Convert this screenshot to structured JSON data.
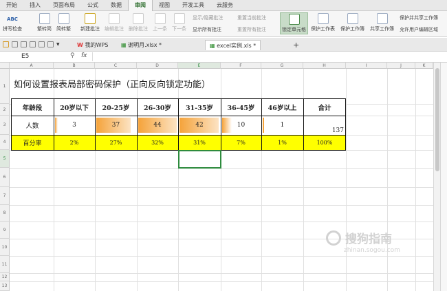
{
  "menu": {
    "tabs": [
      "开始",
      "插入",
      "页面布局",
      "公式",
      "数据",
      "审阅",
      "视图",
      "开发工具",
      "云服务"
    ],
    "active_index": 5
  },
  "ribbon": {
    "spellcheck": "拼写检查",
    "abc": "ABC",
    "trad_to_simp": "繁转简",
    "simp_to_trad": "简转繁",
    "new_comment": "新建批注",
    "edit_comment": "编辑批注",
    "delete_comment": "删除批注",
    "prev": "上一条",
    "next": "下一条",
    "show_hide_comment": "显示/隐藏批注",
    "reset_current_comment": "重置当前批注",
    "show_all_comments": "显示所有批注",
    "reset_all_comments": "重置所有批注",
    "lock_cell": "锁定单元格",
    "protect_sheet": "保护工作表",
    "protect_workbook": "保护工作簿",
    "share_workbook": "共享工作簿",
    "protect_and_share": "保护并共享工作簿",
    "allow_edit_ranges": "允许用户编辑区域"
  },
  "tabbar": {
    "tabs": [
      {
        "label": "我的WPS"
      },
      {
        "label": "谢明月.xlsx *"
      },
      {
        "label": "excel实例.xls *"
      }
    ],
    "add": "+"
  },
  "formula_bar": {
    "name_box": "E5",
    "fx": "fx",
    "content": ""
  },
  "sheet": {
    "columns": [
      "A",
      "B",
      "C",
      "D",
      "E",
      "F",
      "G",
      "H",
      "I",
      "J",
      "K"
    ],
    "rows": [
      "1",
      "2",
      "3",
      "4",
      "5",
      "6",
      "7",
      "8",
      "9",
      "10",
      "11",
      "12",
      "13"
    ],
    "title": "如何设置报表局部密码保护（正向反向锁定功能）",
    "headers": [
      "年龄段",
      "20岁以下",
      "20-25岁",
      "26-30岁",
      "31-35岁",
      "36-45岁",
      "46岁以上",
      "合计"
    ],
    "counts": [
      "人数",
      "3",
      "37",
      "44",
      "42",
      "10",
      "1",
      "137"
    ],
    "percent": [
      "百分率",
      "2%",
      "27%",
      "32%",
      "31%",
      "7%",
      "1%",
      "100%"
    ]
  },
  "watermark": {
    "text": "搜狗指南",
    "subtext": "zhinan.sogou.com"
  },
  "colors": {
    "accent_green": "#2e8b3e",
    "yellow": "#ffff00",
    "orange_bar": "#f5a33a"
  }
}
